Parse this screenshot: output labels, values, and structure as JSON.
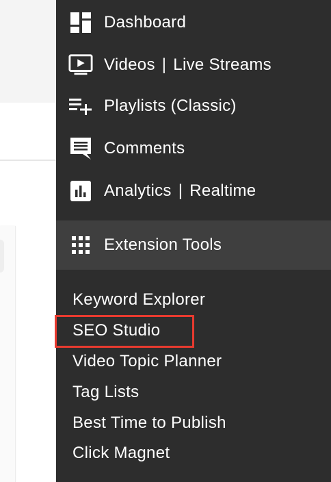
{
  "menu": {
    "items": [
      {
        "icon": "dashboard-icon",
        "parts": [
          "Dashboard"
        ]
      },
      {
        "icon": "video-play-icon",
        "parts": [
          "Videos",
          "|",
          "Live Streams"
        ]
      },
      {
        "icon": "playlist-add-icon",
        "parts": [
          "Playlists (Classic)"
        ]
      },
      {
        "icon": "comment-icon",
        "parts": [
          "Comments"
        ]
      },
      {
        "icon": "analytics-chart-icon",
        "parts": [
          "Analytics",
          "|",
          "Realtime"
        ]
      }
    ],
    "extension": {
      "icon": "grid-icon",
      "label": "Extension Tools"
    },
    "sub_items": [
      "Keyword Explorer",
      "SEO Studio",
      "Video Topic Planner",
      "Tag Lists",
      "Best Time to Publish",
      "Click Magnet"
    ],
    "highlighted_item": "SEO Studio"
  },
  "colors": {
    "menu_bg": "#2d2d2d",
    "extension_band_bg": "#3f3f3f",
    "text": "#ffffff",
    "highlight_border": "#e83a2f"
  }
}
